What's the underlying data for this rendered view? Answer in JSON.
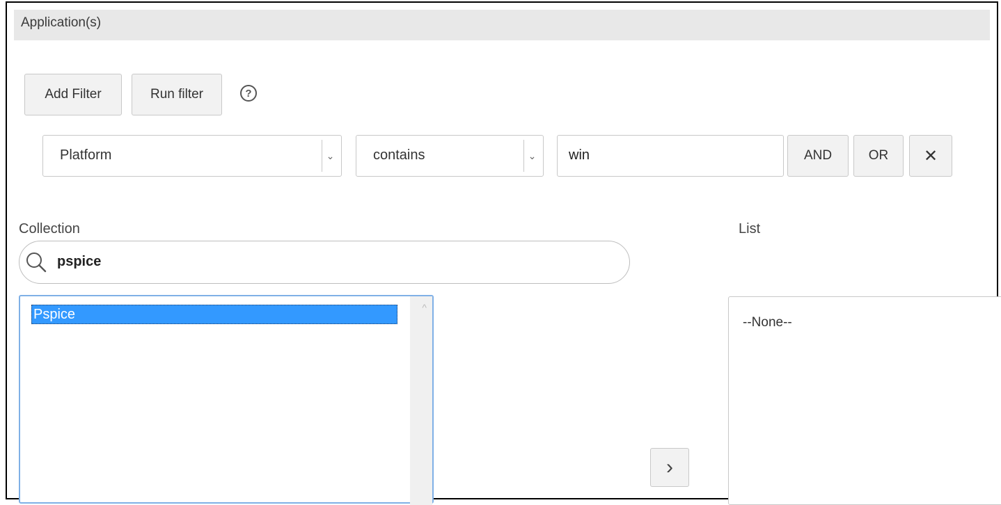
{
  "header": {
    "title": "Application(s)"
  },
  "toolbar": {
    "add_filter_label": "Add Filter",
    "run_filter_label": "Run filter",
    "help_glyph": "?",
    "help_icon": "help-circle-icon"
  },
  "filter_row": {
    "field_value": "Platform",
    "operator_value": "contains",
    "text_value": "win",
    "and_label": "AND",
    "or_label": "OR",
    "remove_glyph": "✕",
    "remove_icon": "close-icon",
    "dropdown_glyph": "⌄"
  },
  "collection": {
    "label": "Collection",
    "search_value": "pspice",
    "search_icon": "search-icon",
    "items": [
      {
        "label": "Pspice",
        "selected": true
      }
    ]
  },
  "list": {
    "label": "List",
    "empty_text": "--None--"
  },
  "move_button": {
    "glyph": "›",
    "icon": "chevron-right-icon"
  },
  "colors": {
    "selection": "#3399ff",
    "header_bg": "#e8e8e8",
    "focus_border": "#7fb0e6"
  }
}
